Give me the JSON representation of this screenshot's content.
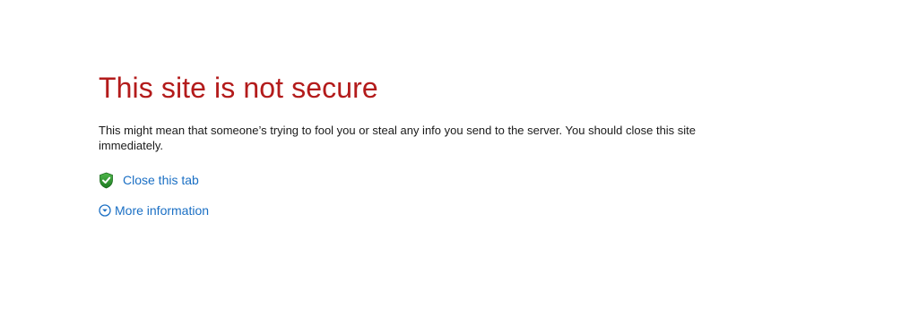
{
  "page": {
    "title": "This site is not secure",
    "description": "This might mean that someone’s trying to fool you or steal any info you send to the server. You should close this site immediately."
  },
  "actions": {
    "close_tab_label": "Close this tab",
    "more_info_label": "More information"
  },
  "icons": {
    "close": "shield-check-icon",
    "more": "chevron-down-circle-icon"
  },
  "colors": {
    "title": "#b31b1b",
    "link": "#1a6fc4",
    "shield": "#2a8a2a"
  }
}
